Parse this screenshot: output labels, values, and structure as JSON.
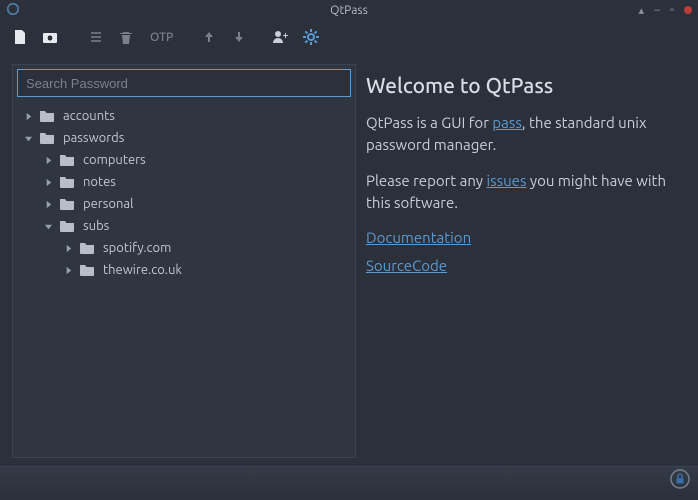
{
  "window": {
    "title": "QtPass"
  },
  "toolbar": {
    "otp_label": "OTP"
  },
  "search": {
    "placeholder": "Search Password",
    "value": ""
  },
  "tree": [
    {
      "depth": 0,
      "expanded": false,
      "label": "accounts"
    },
    {
      "depth": 0,
      "expanded": true,
      "label": "passwords"
    },
    {
      "depth": 1,
      "expanded": false,
      "label": "computers"
    },
    {
      "depth": 1,
      "expanded": false,
      "label": "notes"
    },
    {
      "depth": 1,
      "expanded": false,
      "label": "personal"
    },
    {
      "depth": 1,
      "expanded": true,
      "label": "subs"
    },
    {
      "depth": 2,
      "expanded": false,
      "label": "spotify.com"
    },
    {
      "depth": 2,
      "expanded": false,
      "label": "thewire.co.uk"
    }
  ],
  "content": {
    "heading": "Welcome to QtPass",
    "intro_prefix": "QtPass is a GUI for ",
    "intro_link": "pass",
    "intro_suffix": ", the standard unix password manager.",
    "report_prefix": "Please report any ",
    "report_link": "issues",
    "report_suffix": " you might have with this software.",
    "doc_link": "Documentation",
    "source_link": "SourceCode"
  }
}
